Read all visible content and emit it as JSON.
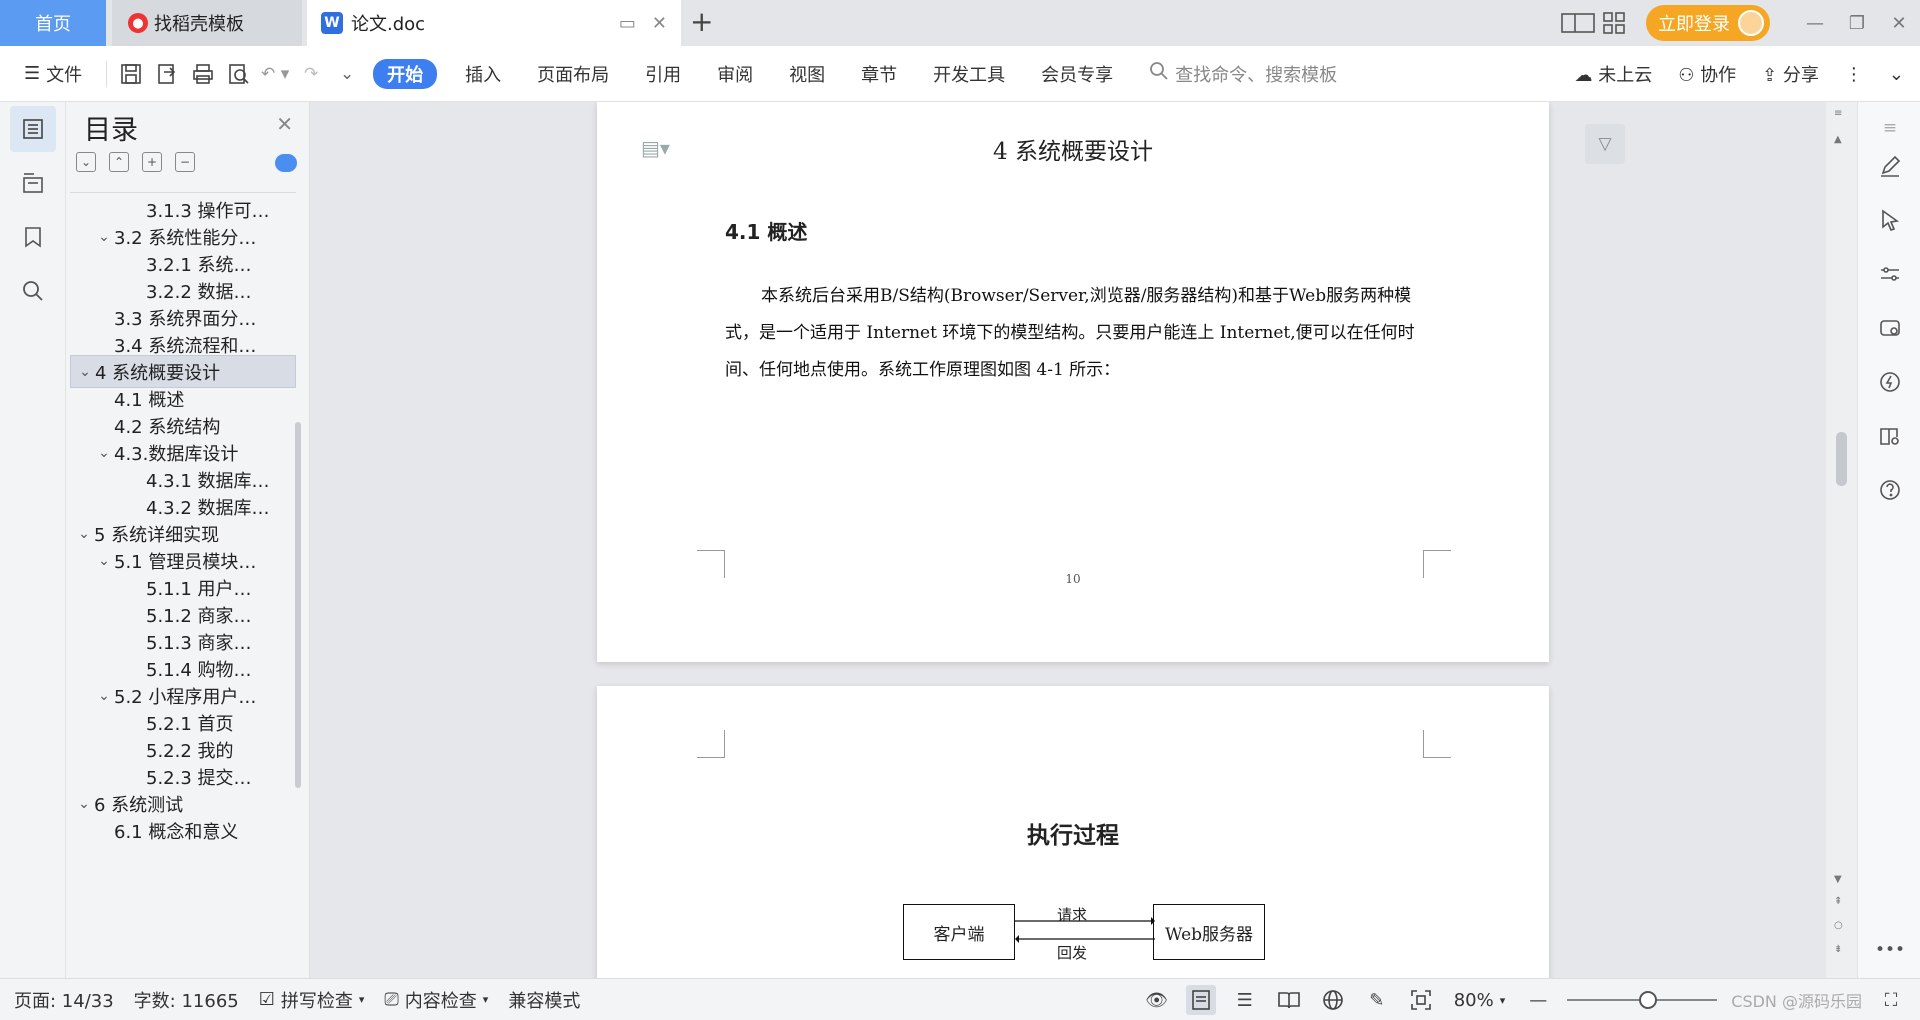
{
  "tabs": {
    "home": "首页",
    "daoke": "找稻壳模板",
    "doc": "论文.doc"
  },
  "titlebar": {
    "login": "立即登录"
  },
  "ribbon": {
    "file": "文件",
    "menus": [
      "开始",
      "插入",
      "页面布局",
      "引用",
      "审阅",
      "视图",
      "章节",
      "开发工具",
      "会员专享"
    ],
    "search_placeholder": "查找命令、搜索模板",
    "cloud": "未上云",
    "collab": "协作",
    "share": "分享"
  },
  "toc": {
    "title": "目录",
    "items": [
      {
        "label": "3.1.3 操作可…",
        "level": 3,
        "chev": false
      },
      {
        "label": "3.2 系统性能分…",
        "level": 2,
        "chev": true
      },
      {
        "label": "3.2.1  系统…",
        "level": 3,
        "chev": false
      },
      {
        "label": "3.2.2  数据…",
        "level": 3,
        "chev": false
      },
      {
        "label": "3.3 系统界面分…",
        "level": 2,
        "chev": false
      },
      {
        "label": "3.4 系统流程和…",
        "level": 2,
        "chev": false
      },
      {
        "label": "4 系统概要设计",
        "level": 1,
        "chev": true,
        "selected": true
      },
      {
        "label": "4.1 概述",
        "level": 2,
        "chev": false
      },
      {
        "label": "4.2 系统结构",
        "level": 2,
        "chev": false
      },
      {
        "label": "4.3.数据库设计",
        "level": 2,
        "chev": true
      },
      {
        "label": "4.3.1 数据库…",
        "level": 3,
        "chev": false
      },
      {
        "label": "4.3.2 数据库…",
        "level": 3,
        "chev": false
      },
      {
        "label": "5 系统详细实现",
        "level": 1,
        "chev": true
      },
      {
        "label": "5.1  管理员模块…",
        "level": 2,
        "chev": true
      },
      {
        "label": "5.1.1  用户…",
        "level": 3,
        "chev": false
      },
      {
        "label": "5.1.2  商家…",
        "level": 3,
        "chev": false
      },
      {
        "label": "5.1.3  商家…",
        "level": 3,
        "chev": false
      },
      {
        "label": "5.1.4  购物…",
        "level": 3,
        "chev": false
      },
      {
        "label": "5.2  小程序用户…",
        "level": 2,
        "chev": true
      },
      {
        "label": "5.2.1  首页",
        "level": 3,
        "chev": false
      },
      {
        "label": "5.2.2  我的",
        "level": 3,
        "chev": false
      },
      {
        "label": "5.2.3  提交…",
        "level": 3,
        "chev": false
      },
      {
        "label": "6 系统测试",
        "level": 1,
        "chev": true
      },
      {
        "label": "6.1 概念和意义",
        "level": 2,
        "chev": false
      }
    ]
  },
  "document": {
    "heading1": "4 系统概要设计",
    "heading2": "4.1 概述",
    "paragraph": "本系统后台采用B/S结构(Browser/Server,浏览器/服务器结构)和基于Web服务两种模式，是一个适用于 Internet 环境下的模型结构。只要用户能连上 Internet,便可以在任何时间、任何地点使用。系统工作原理图如图 4-1 所示：",
    "page_number": "10",
    "figure": {
      "title": "执行过程",
      "client": "客户端",
      "server": "Web服务器",
      "request": "请求",
      "response": "回发"
    }
  },
  "statusbar": {
    "page": "页面: 14/33",
    "words": "字数: 11665",
    "spellcheck": "拼写检查",
    "content_check": "内容检查",
    "compat": "兼容模式",
    "zoom": "80%",
    "watermark": "CSDN @源码乐园"
  },
  "colors": {
    "accent": "#3d7ff0",
    "login": "#f5a623",
    "home_tab": "#5b9bf1"
  }
}
